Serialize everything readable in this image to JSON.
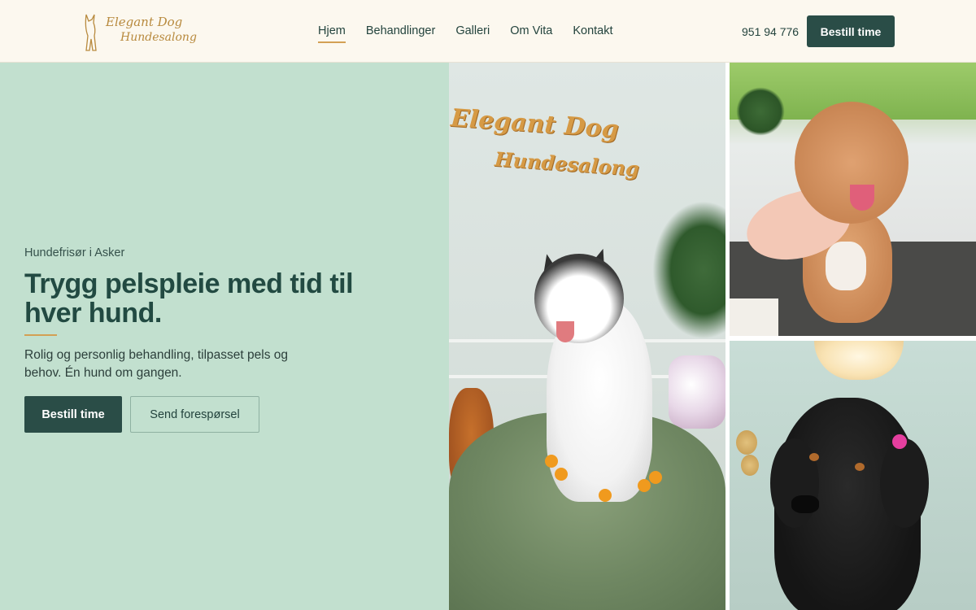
{
  "header": {
    "logo_line1": "Elegant Dog",
    "logo_line2": "Hundesalong",
    "nav": [
      {
        "label": "Hjem",
        "active": true
      },
      {
        "label": "Behandlinger",
        "active": false
      },
      {
        "label": "Galleri",
        "active": false
      },
      {
        "label": "Om Vita",
        "active": false
      },
      {
        "label": "Kontakt",
        "active": false
      }
    ],
    "phone": "951 94 776",
    "cta_label": "Bestill time"
  },
  "hero": {
    "eyebrow": "Hundefrisør i Asker",
    "headline": "Trygg pelspleie med tid til hver hund.",
    "subtext": "Rolig og personlig behandling, tilpasset pels og behov. Én hund om gangen.",
    "primary_button": "Bestill time",
    "secondary_button": "Send forespørsel"
  },
  "gallery": {
    "photo1_sign_line1": "Elegant Dog",
    "photo1_sign_line2": "Hundesalong"
  },
  "colors": {
    "accent": "#d3a054",
    "primary_dark": "#2a4d47",
    "hero_bg": "#c2e0cf",
    "header_bg": "#fcf8ef"
  }
}
